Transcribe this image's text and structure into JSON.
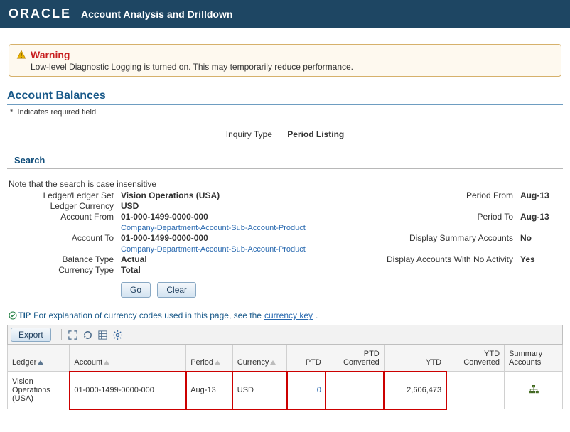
{
  "header": {
    "logo_text": "ORACLE",
    "title": "Account Analysis and Drilldown"
  },
  "warning": {
    "title": "Warning",
    "message": "Low-level Diagnostic Logging is turned on. This may temporarily reduce performance."
  },
  "page": {
    "section_title": "Account Balances",
    "required_note": "Indicates required field"
  },
  "inquiry": {
    "label": "Inquiry Type",
    "value": "Period Listing"
  },
  "search": {
    "header": "Search",
    "note": "Note that the search is case insensitive",
    "left": {
      "ledger_set_label": "Ledger/Ledger Set",
      "ledger_set_value": "Vision Operations (USA)",
      "ledger_currency_label": "Ledger Currency",
      "ledger_currency_value": "USD",
      "account_from_label": "Account From",
      "account_from_value": "01-000-1499-0000-000",
      "account_hint": "Company-Department-Account-Sub-Account-Product",
      "account_to_label": "Account To",
      "account_to_value": "01-000-1499-0000-000",
      "balance_type_label": "Balance Type",
      "balance_type_value": "Actual",
      "currency_type_label": "Currency Type",
      "currency_type_value": "Total"
    },
    "right": {
      "period_from_label": "Period From",
      "period_from_value": "Aug-13",
      "period_to_label": "Period To",
      "period_to_value": "Aug-13",
      "display_summary_label": "Display Summary Accounts",
      "display_summary_value": "No",
      "display_noactivity_label": "Display Accounts With No Activity",
      "display_noactivity_value": "Yes"
    },
    "buttons": {
      "go": "Go",
      "clear": "Clear"
    }
  },
  "tip": {
    "badge": "TIP",
    "text": "For explanation of currency codes used in this page, see the ",
    "link_text": "currency key"
  },
  "toolbar": {
    "export": "Export"
  },
  "table": {
    "columns": {
      "ledger": "Ledger",
      "account": "Account",
      "period": "Period",
      "currency": "Currency",
      "ptd": "PTD",
      "ptd_conv": "PTD Converted",
      "ytd": "YTD",
      "ytd_conv": "YTD Converted",
      "summary": "Summary Accounts"
    },
    "rows": [
      {
        "ledger": "Vision Operations (USA)",
        "account": "01-000-1499-0000-000",
        "period": "Aug-13",
        "currency": "USD",
        "ptd": "0",
        "ptd_conv": "",
        "ytd": "2,606,473",
        "ytd_conv": ""
      }
    ]
  }
}
